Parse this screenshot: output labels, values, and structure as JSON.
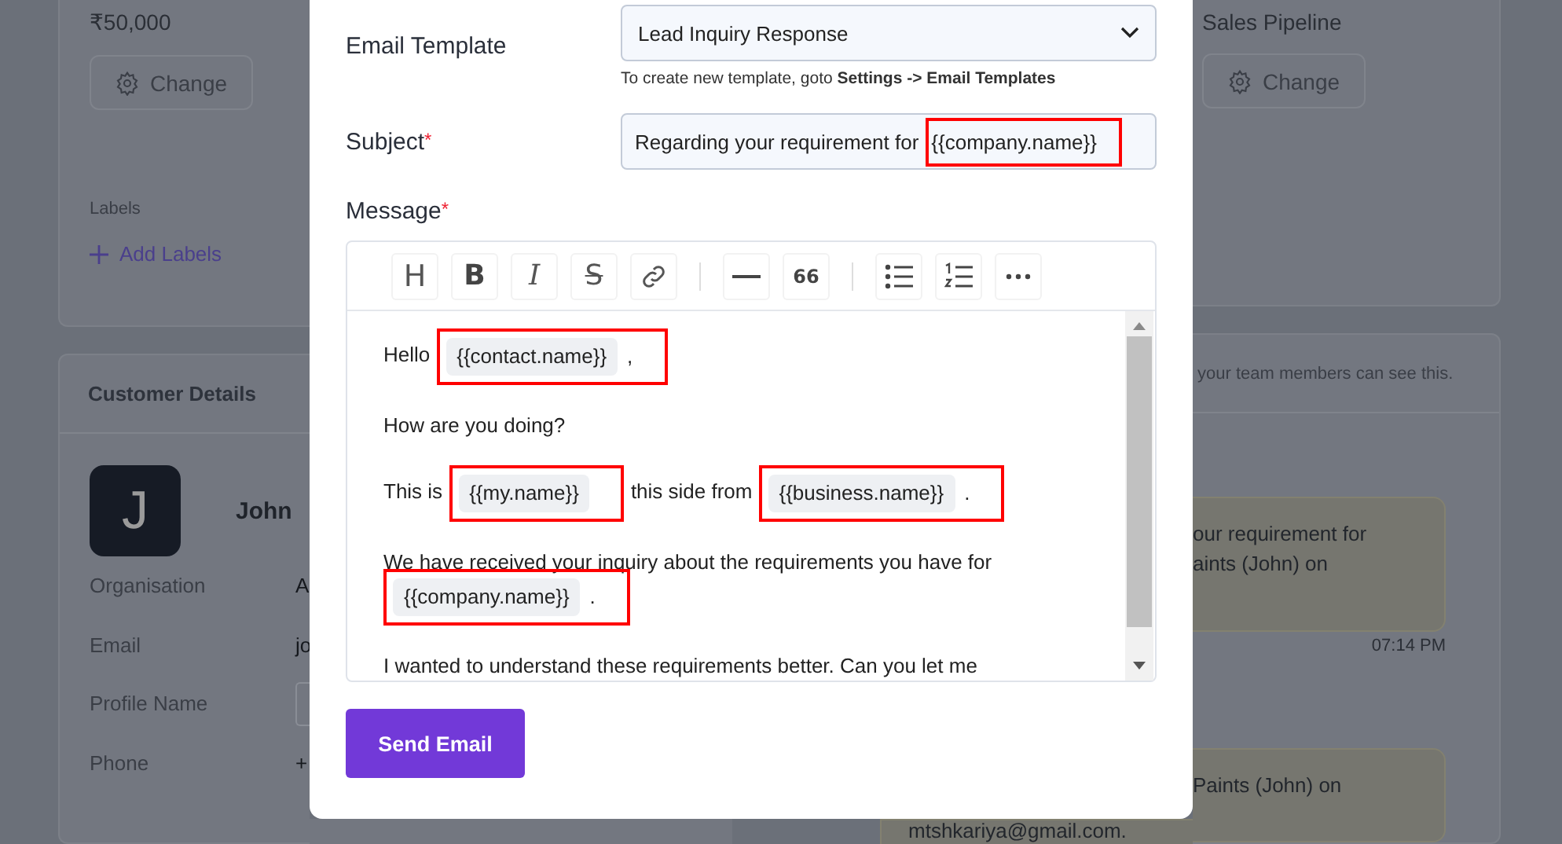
{
  "background_page": {
    "left_card": {
      "amount": "₹50,000",
      "change_button": "Change",
      "labels_heading": "Labels",
      "add_labels_link": "Add Labels"
    },
    "customer_details": {
      "title": "Customer Details",
      "avatar_letter": "J",
      "name": "John",
      "fields": [
        {
          "label": "Organisation",
          "kind": "value",
          "value": "A"
        },
        {
          "label": "Email",
          "kind": "value",
          "value": "jo"
        },
        {
          "label": "Profile Name",
          "kind": "input"
        },
        {
          "label": "Phone",
          "kind": "value",
          "value": "+"
        }
      ]
    },
    "right_card": {
      "pipeline": "Sales Pipeline",
      "change_button": "Change"
    },
    "notes_panel": {
      "notice": "your team members can see this.",
      "messages": [
        {
          "lines": [
            "our requirement for",
            "aints (John) on"
          ],
          "time": "07:14 PM"
        },
        {
          "lines": [
            "Paints (John) on"
          ]
        }
      ],
      "below_modal_text": "mtshkariya@gmail.com."
    }
  },
  "modal": {
    "template": {
      "label": "Email Template",
      "value": "Lead Inquiry Response",
      "hint": "To create new template, goto **Settings -> Email Templates**"
    },
    "subject": {
      "label": "Subject",
      "required_mark": "*",
      "text": "Regarding your requirement for",
      "variable": "{{company.name}}",
      "highlighted": true
    },
    "message": {
      "label": "Message",
      "required_mark": "*",
      "toolbar": [
        {
          "kind": "heading",
          "label": "H"
        },
        {
          "kind": "bold",
          "label": "B"
        },
        {
          "kind": "italic",
          "label": "I"
        },
        {
          "kind": "strike",
          "label": "S"
        },
        {
          "kind": "link"
        },
        {
          "kind": "separator"
        },
        {
          "kind": "rule"
        },
        {
          "kind": "quote",
          "label": "66"
        },
        {
          "kind": "separator"
        },
        {
          "kind": "bullets"
        },
        {
          "kind": "numbers"
        },
        {
          "kind": "more"
        }
      ],
      "paragraphs": [
        [
          {
            "kind": "text",
            "text": "Hello"
          },
          {
            "kind": "variable",
            "text": "{{contact.name}}",
            "suffix": ",",
            "highlighted": true
          }
        ],
        [
          {
            "kind": "text",
            "text": "How are you doing?"
          }
        ],
        [
          {
            "kind": "text",
            "text": "This is"
          },
          {
            "kind": "variable",
            "text": "{{my.name}}",
            "highlighted": true
          },
          {
            "kind": "text",
            "text": "this side from"
          },
          {
            "kind": "variable",
            "text": "{{business.name}}",
            "suffix": ".",
            "highlighted": true
          }
        ],
        [
          {
            "kind": "text",
            "text": "We have received your inquiry about the requirements you have for"
          },
          {
            "kind": "variable",
            "text": "{{company.name}}",
            "suffix": ".",
            "highlighted": true
          }
        ],
        [
          {
            "kind": "text",
            "text": "I wanted to understand these requirements better. Can you let me"
          }
        ]
      ]
    },
    "send_button": "Send Email"
  }
}
